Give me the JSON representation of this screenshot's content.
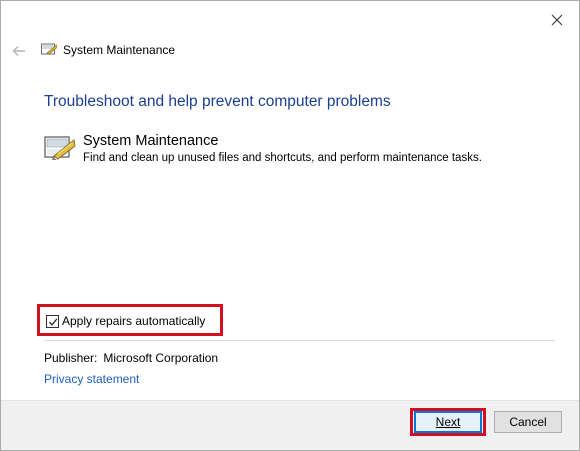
{
  "window": {
    "title": "System Maintenance"
  },
  "main": {
    "heading": "Troubleshoot and help prevent computer problems",
    "tool": {
      "name": "System Maintenance",
      "description": "Find and clean up unused files and shortcuts, and perform maintenance tasks."
    },
    "apply_repairs": {
      "label": "Apply repairs automatically",
      "checked": true
    },
    "publisher": {
      "label": "Publisher:",
      "value": "Microsoft Corporation"
    },
    "privacy_link": "Privacy statement"
  },
  "footer": {
    "next_label": "Next",
    "cancel_label": "Cancel"
  },
  "colors": {
    "heading": "#1a3f8f",
    "link": "#1c61b8",
    "highlight": "#d0101e",
    "focus": "#0078d7"
  },
  "icons": {
    "back": "back-arrow-icon",
    "close": "close-icon",
    "title": "system-maintenance-icon",
    "tool": "system-maintenance-icon"
  }
}
